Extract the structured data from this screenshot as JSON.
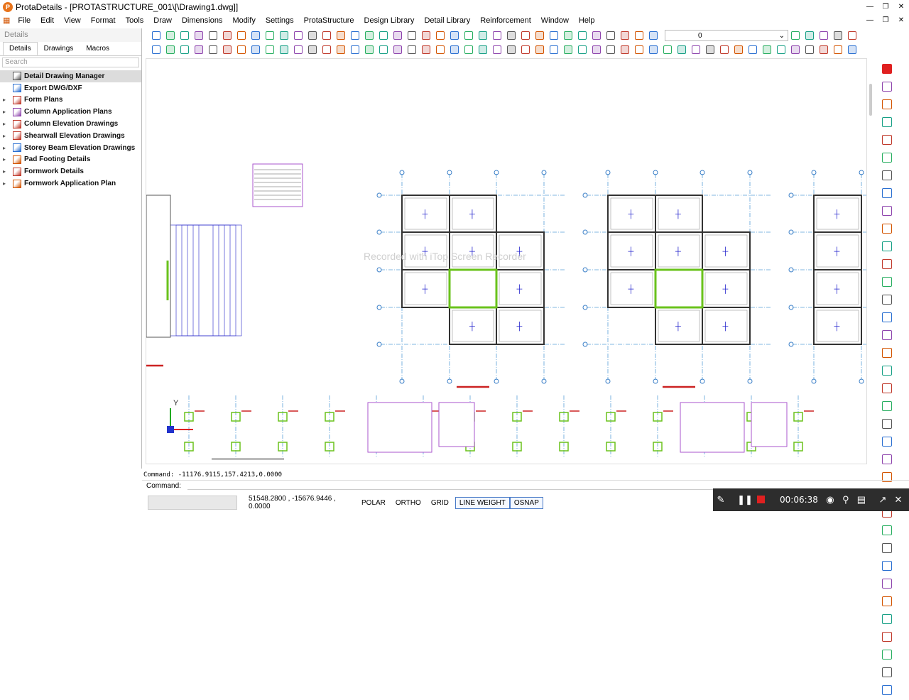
{
  "window": {
    "title": "ProtaDetails - [PROTASTRUCTURE_001\\[\\Drawing1.dwg]]"
  },
  "menu": [
    "File",
    "Edit",
    "View",
    "Format",
    "Tools",
    "Draw",
    "Dimensions",
    "Modify",
    "Settings",
    "ProtaStructure",
    "Design Library",
    "Detail Library",
    "Reinforcement",
    "Window",
    "Help"
  ],
  "panel": {
    "header": "Details",
    "tabs": [
      "Details",
      "Drawings",
      "Macros"
    ],
    "search_placeholder": "Search",
    "items": [
      {
        "label": "Detail Drawing Manager",
        "expandable": false,
        "icon": "manager-icon",
        "color": "#555555"
      },
      {
        "label": "Export DWG/DXF",
        "expandable": false,
        "icon": "export-icon",
        "color": "#2a6fd1"
      },
      {
        "label": "Form Plans",
        "expandable": true,
        "icon": "form-plan-icon",
        "color": "#c0392b"
      },
      {
        "label": "Column Application Plans",
        "expandable": true,
        "icon": "column-plan-icon",
        "color": "#8e44ad"
      },
      {
        "label": "Column Elevation Drawings",
        "expandable": true,
        "icon": "column-elevation-icon",
        "color": "#c0392b"
      },
      {
        "label": "Shearwall Elevation Drawings",
        "expandable": true,
        "icon": "shearwall-icon",
        "color": "#c0392b"
      },
      {
        "label": "Storey Beam Elevation Drawings",
        "expandable": true,
        "icon": "beam-elevation-icon",
        "color": "#2a6fd1"
      },
      {
        "label": "Pad Footing Details",
        "expandable": true,
        "icon": "footing-icon",
        "color": "#d35400"
      },
      {
        "label": "Formwork Details",
        "expandable": true,
        "icon": "formwork-icon",
        "color": "#c0392b"
      },
      {
        "label": "Formwork Application Plan",
        "expandable": true,
        "icon": "formwork-plan-icon",
        "color": "#d35400"
      }
    ]
  },
  "toolbar": {
    "layer_value": "0"
  },
  "canvas": {
    "watermark": "Recorded with iTop Screen Recorder"
  },
  "command": {
    "history": "Command: -11176.9115,157.4213,0.0000",
    "prompt_label": "Command:"
  },
  "status": {
    "coords": "51548.2800 , -15676.9446 , 0.0000",
    "toggles": [
      {
        "label": "POLAR",
        "on": false
      },
      {
        "label": "ORTHO",
        "on": false
      },
      {
        "label": "GRID",
        "on": false
      },
      {
        "label": "LINE WEIGHT",
        "on": true
      },
      {
        "label": "OSNAP",
        "on": true
      }
    ]
  },
  "recorder": {
    "time": "00:06:38"
  }
}
